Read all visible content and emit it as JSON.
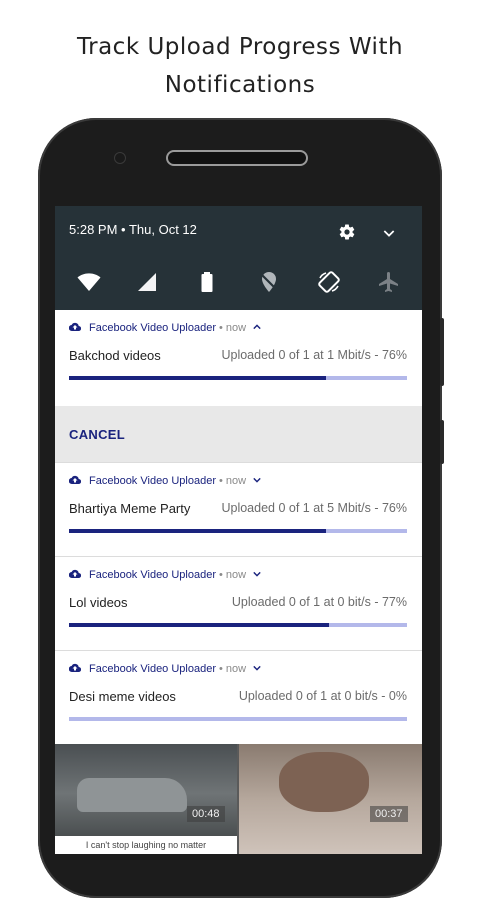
{
  "headline": {
    "line1": "Track Upload Progress With",
    "line2": "Notifications"
  },
  "statusbar": {
    "time_date": "5:28 PM • Thu, Oct 12",
    "icons": [
      "settings-gear-icon",
      "expand-chevron-icon"
    ],
    "quick_settings": [
      "wifi-icon",
      "cellular-signal-icon",
      "battery-icon",
      "location-off-icon",
      "auto-rotate-icon",
      "airplane-mode-icon"
    ]
  },
  "notifications": [
    {
      "app": "Facebook Video Uploader",
      "time": "now",
      "expanded": true,
      "title": "Bakchod videos",
      "status": "Uploaded 0 of 1 at 1 Mbit/s - 76%",
      "progress": 0.76
    },
    {
      "app": "Facebook Video Uploader",
      "time": "now",
      "expanded": false,
      "title": "Bhartiya Meme Party",
      "status": "Uploaded 0 of 1 at 5 Mbit/s - 76%",
      "progress": 0.76
    },
    {
      "app": "Facebook Video Uploader",
      "time": "now",
      "expanded": false,
      "title": "Lol videos",
      "status": "Uploaded 0 of 1 at 0 bit/s - 77%",
      "progress": 0.77
    },
    {
      "app": "Facebook Video Uploader",
      "time": "now",
      "expanded": false,
      "title": "Desi meme videos",
      "status": "Uploaded 0 of 1 at 0 bit/s - 0%",
      "progress": 0.0
    }
  ],
  "cancel_action": "CANCEL",
  "background": {
    "left_duration": "00:48",
    "right_duration": "00:37",
    "left_caption": "I can't stop laughing no matter"
  },
  "colors": {
    "statusbar_bg": "#263238",
    "accent": "#1a237e",
    "progress_track": "#b3b8ea"
  }
}
